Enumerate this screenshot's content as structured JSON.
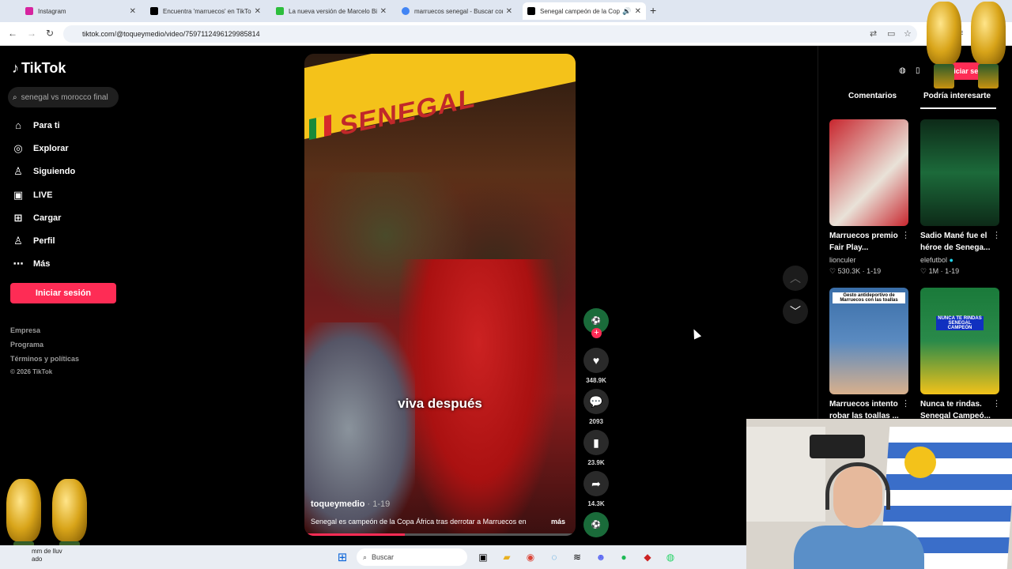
{
  "browser": {
    "tabs": [
      {
        "title": "Instagram",
        "favicon_color": "#d6249f",
        "active": false
      },
      {
        "title": "Encuentra 'marruecos' en TikTo",
        "favicon_color": "#000000",
        "active": false
      },
      {
        "title": "La nueva versión de Marcelo Bi",
        "favicon_color": "#2dbe3c",
        "active": false
      },
      {
        "title": "marruecos senegal - Buscar con",
        "favicon_color": "#4285f4",
        "active": false
      },
      {
        "title": "Senegal campeón de la Cop",
        "favicon_color": "#000000",
        "active": true
      }
    ],
    "url": "tiktok.com/@toqueymedio/video/7597112496129985814"
  },
  "sidebar": {
    "logo": "TikTok",
    "search_placeholder": "senegal vs morocco final",
    "nav": [
      {
        "label": "Para ti",
        "icon": "home-icon"
      },
      {
        "label": "Explorar",
        "icon": "compass-icon"
      },
      {
        "label": "Siguiendo",
        "icon": "following-icon"
      },
      {
        "label": "LIVE",
        "icon": "live-icon"
      },
      {
        "label": "Cargar",
        "icon": "upload-icon"
      },
      {
        "label": "Perfil",
        "icon": "profile-icon"
      },
      {
        "label": "Más",
        "icon": "more-icon"
      }
    ],
    "login": "Iniciar sesión",
    "footer": [
      "Empresa",
      "Programa",
      "Términos y políticas",
      "© 2026 TikTok"
    ]
  },
  "video": {
    "banner": "SENEGAL",
    "caption": "viva después",
    "author": "toqueymedio",
    "date": "· 1-19",
    "description": "Senegal es campeón de la Copa África tras derrotar a Marruecos en",
    "more": "más",
    "progress": 0.37
  },
  "actions": {
    "likes": "348.9K",
    "comments": "2093",
    "saves": "23.9K",
    "shares": "14.3K"
  },
  "right_panel": {
    "tab_comments": "Comentarios",
    "tab_interesting": "Podría interesarte",
    "login": "Iniciar sesión",
    "cards": [
      {
        "title": "Marruecos premio Fair Play...",
        "author": "lionculer",
        "stats": "♡ 530.3K · 1-19",
        "colors": [
          "#c8262e",
          "#e9e2d8"
        ]
      },
      {
        "title": "Sadio Mané fue el héroe de Senega...",
        "author": "elefutbol",
        "stats": "♡ 1M · 1-19",
        "colors": [
          "#1c6a3a",
          "#0d2a18"
        ]
      },
      {
        "title": "Marruecos intento robar las toallas ...",
        "author": "",
        "stats": "",
        "label": "Gesto antideportivo de Marruecos con las toallas",
        "colors": [
          "#3a6ea8",
          "#d9b08c"
        ]
      },
      {
        "title": "Nunca te rindas. Senegal Campeó...",
        "author": "",
        "stats": "",
        "label": "NUNCA TE RINDAS SENEGAL CAMPEÓN",
        "colors": [
          "#1a7a3a",
          "#f2c21a"
        ]
      }
    ]
  },
  "taskbar": {
    "search": "Buscar",
    "weather_label": "mm de lluv",
    "weather_sub": "ado"
  }
}
